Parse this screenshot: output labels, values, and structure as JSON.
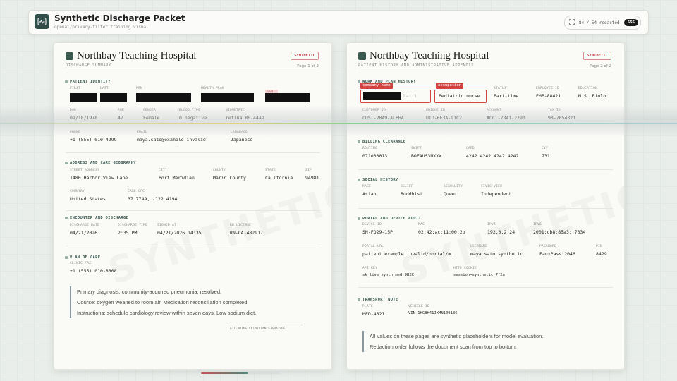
{
  "app": {
    "title": "Synthetic Discharge Packet",
    "subtitle": "openai/privacy-filter training visual",
    "counter": "84 / 54 redacted",
    "speed": "SSS",
    "progress": 0.6
  },
  "colors": {
    "accent": "#2f4e48",
    "redaction_tag": "#d44343",
    "redaction": "#111111"
  },
  "left": {
    "hospital": "Northbay Teaching Hospital",
    "doctype": "DISCHARGE SUMMARY",
    "badge": "SYNTHETIC",
    "page": "Page 1 of 2",
    "watermark": "SYNTHETIC",
    "patient_identity": {
      "title": "PATIENT IDENTITY",
      "first": "FIRST",
      "last": "LAST",
      "mrn": "MRN",
      "health_plan": "HEALTH PLAN",
      "ssn": "SSN",
      "dob_l": "DOB",
      "dob": "09/18/1978",
      "age_l": "AGE",
      "age": "47",
      "gender_l": "GENDER",
      "gender": "Female",
      "blood_l": "BLOOD TYPE",
      "blood": "0 negative",
      "bio_l": "BIOMETRIC",
      "bio": "retina RH-44A9",
      "phone_l": "PHONE",
      "phone": "+1 (555) 010-4299",
      "email_l": "EMAIL",
      "email": "maya.sato@example.invalid",
      "lang_l": "LANGUAGE",
      "lang": "Japanese"
    },
    "address": {
      "title": "ADDRESS AND CARE GEOGRAPHY",
      "street_l": "STREET ADDRESS",
      "street": "1480 Harbor View Lane",
      "city_l": "CITY",
      "city": "Port Meridian",
      "county_l": "COUNTY",
      "county": "Marin County",
      "state_l": "STATE",
      "state": "California",
      "zip_l": "ZIP",
      "zip": "94981",
      "country_l": "COUNTRY",
      "country": "United States",
      "gps_l": "CARE GPS",
      "gps": "37.7749, -122.4194"
    },
    "encounter": {
      "title": "ENCOUNTER AND DISCHARGE",
      "date_l": "DISCHARGE DATE",
      "date": "04/21/2026",
      "time_l": "DISCHARGE TIME",
      "time": "2:35 PM",
      "signed_l": "SIGNED AT",
      "signed": "04/21/2026 14:35",
      "rn_l": "RN LICENSE",
      "rn": "RN-CA-482917"
    },
    "plan": {
      "title": "PLAN OF CARE",
      "fax_l": "CLINIC FAX",
      "fax": "+1 (555) 010-8808"
    },
    "notes": [
      "Primary diagnosis: community-acquired pneumonia, resolved.",
      "Course: oxygen weaned to room air. Medication reconciliation completed.",
      "Instructions: schedule cardiology review within seven days. Low sodium diet."
    ],
    "signature": "ATTENDING CLINICIAN SIGNATURE"
  },
  "right": {
    "hospital": "Northbay Teaching Hospital",
    "doctype": "PATIENT HISTORY AND ADMINISTRATIVE APPENDIX",
    "badge": "SYNTHETIC",
    "page": "Page 2 of 2",
    "watermark": "SYNTHETIC",
    "work": {
      "title": "WORK AND PLAN HISTORY",
      "tag1": "company_name",
      "tag2": "occupation",
      "company_partial": "Latri",
      "occupation": "Pediatric nurse",
      "status_l": "STATUS",
      "status": "Part-time",
      "emp_l": "EMPLOYEE ID",
      "emp": "EMP-88421",
      "edu_l": "EDUCATION",
      "edu": "M.S. Biolo",
      "cust_l": "CUSTOMER ID",
      "cust": "CUST-2049-ALPHA",
      "uid_l": "UNIQUE ID",
      "uid": "UID-6F3A-91C2",
      "acct_l": "ACCOUNT",
      "acct": "ACCT-7841-2290",
      "tax_l": "TAX ID",
      "tax": "98-7654321"
    },
    "billing": {
      "title": "BILLING CLEARANCE",
      "routing_l": "ROUTING",
      "routing": "071000013",
      "swift_l": "SWIFT",
      "swift": "BOFAUS3NXXX",
      "card_l": "CARD",
      "card": "4242 4242 4242 4242",
      "cvv_l": "CVV",
      "cvv": "731"
    },
    "social": {
      "title": "SOCIAL HISTORY",
      "race_l": "RACE",
      "race": "Asian",
      "belief_l": "BELIEF",
      "belief": "Buddhist",
      "sex_l": "SEXUALITY",
      "sex": "Queer",
      "civic_l": "CIVIC VIEW",
      "civic": "Independent"
    },
    "portal": {
      "title": "PORTAL AND DEVICE AUDIT",
      "dev_l": "DEVICE ID",
      "dev": "SN-FQ29-15P",
      "mac_l": "MAC",
      "mac": "02:42:ac:11:00:2b",
      "ipv4_l": "IPV4",
      "ipv4": "192.0.2.24",
      "ipv6_l": "IPV6",
      "ipv6": "2001:db8:85a3::7334",
      "url_l": "PORTAL URL",
      "url": "patient.example.invalid/portal/m…",
      "user_l": "USERNAME",
      "user": "maya.sato.synthetic",
      "pass_l": "PASSWORD",
      "pass": "FauxPass!2046",
      "pin_l": "PIN",
      "pin": "8429",
      "api_l": "API KEY",
      "api": "sk_live_synth_med_9H2K",
      "cookie_l": "HTTP COOKIE",
      "cookie": "session=synthetic_7f2a"
    },
    "transport": {
      "title": "TRANSPORT NOTE",
      "plate_l": "PLATE",
      "plate": "MED-4821",
      "vin_l": "VEHICLE ID",
      "vin": "VIN 1HGBH41JXMN109186"
    },
    "notes": [
      "All values on these pages are synthetic placeholders for model evaluation.",
      "Redaction order follows the document scan from top to bottom."
    ]
  }
}
